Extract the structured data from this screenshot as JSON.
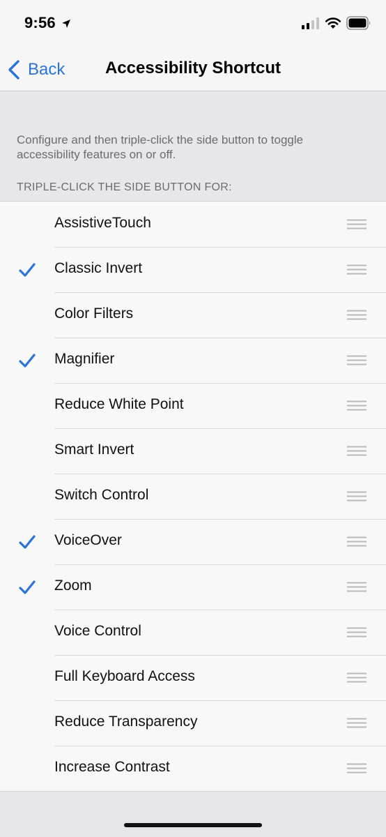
{
  "status_bar": {
    "time": "9:56"
  },
  "nav": {
    "back_label": "Back",
    "title": "Accessibility Shortcut"
  },
  "description": "Configure and then triple-click the side button to toggle accessibility features on or off.",
  "section_header": "TRIPLE-CLICK THE SIDE BUTTON FOR:",
  "accent_color": "#2a74d8",
  "icons": {
    "check": "checkmark-icon",
    "reorder": "reorder-handle-icon"
  },
  "items": [
    {
      "label": "AssistiveTouch",
      "checked": false
    },
    {
      "label": "Classic Invert",
      "checked": true
    },
    {
      "label": "Color Filters",
      "checked": false
    },
    {
      "label": "Magnifier",
      "checked": true
    },
    {
      "label": "Reduce White Point",
      "checked": false
    },
    {
      "label": "Smart Invert",
      "checked": false
    },
    {
      "label": "Switch Control",
      "checked": false
    },
    {
      "label": "VoiceOver",
      "checked": true
    },
    {
      "label": "Zoom",
      "checked": true
    },
    {
      "label": "Voice Control",
      "checked": false
    },
    {
      "label": "Full Keyboard Access",
      "checked": false
    },
    {
      "label": "Reduce Transparency",
      "checked": false
    },
    {
      "label": "Increase Contrast",
      "checked": false
    }
  ]
}
